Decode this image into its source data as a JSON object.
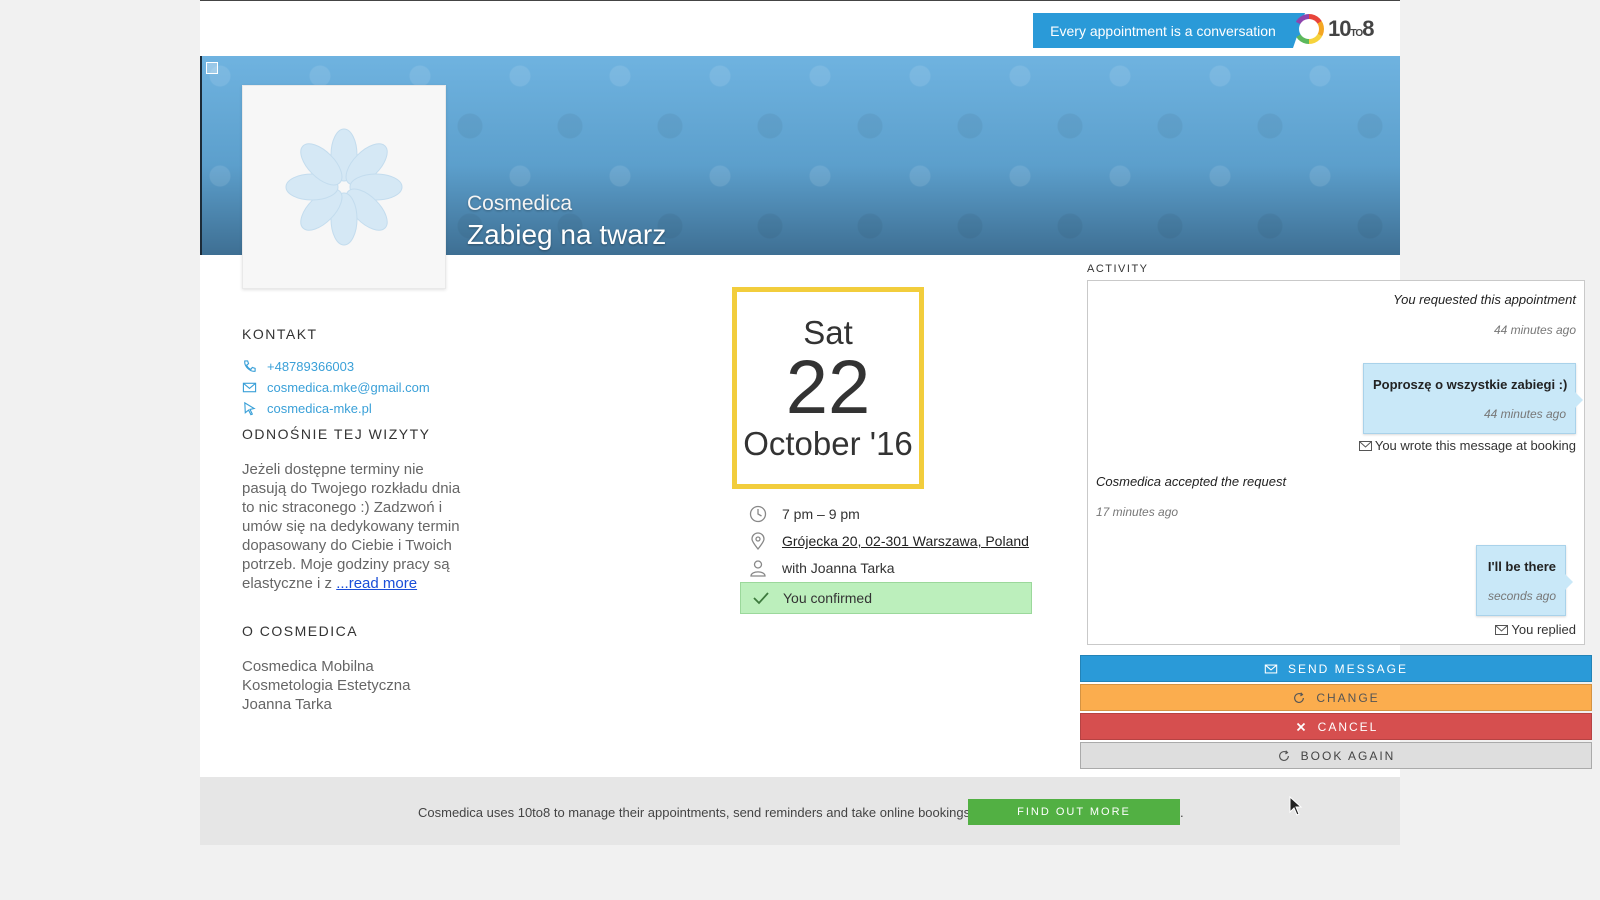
{
  "header": {
    "tagline": "Every appointment is a conversation",
    "logo": {
      "main": "10",
      "small": "TO",
      "end": "8"
    }
  },
  "banner": {
    "business": "Cosmedica",
    "service": "Zabieg na twarz"
  },
  "sidebar": {
    "contact_heading": "KONTAKT",
    "phone": "+48789366003",
    "email": "cosmedica.mke@gmail.com",
    "website": "cosmedica-mke.pl",
    "visit_heading": "ODNOŚNIE TEJ WIZYTY",
    "visit_text": "Jeżeli dostępne terminy nie pasują do Twojego rozkładu dnia to nic straconego :) Zadzwoń i umów się na dedykowany termin dopasowany do Ciebie i Twoich potrzeb. Moje godziny pracy są elastyczne i z",
    "read_more": "...read more",
    "about_heading": "O COSMEDICA",
    "about_text": "Cosmedica Mobilna Kosmetologia Estetyczna Joanna Tarka"
  },
  "appointment": {
    "day_of_week": "Sat",
    "day": "22",
    "month_year": "October '16",
    "time": "7 pm – 9 pm",
    "address": "Grójecka 20, 02-301 Warszawa, Poland",
    "with": "with Joanna Tarka",
    "status": "You confirmed"
  },
  "activity": {
    "heading": "ACTIVITY",
    "items": [
      {
        "text": "You requested this appointment",
        "time": "44 minutes ago"
      },
      {
        "message": "Poproszę o wszystkie zabiegi :)",
        "time": "44 minutes ago",
        "note": "You wrote this message at booking"
      },
      {
        "text": "Cosmedica accepted the request",
        "time": "17 minutes ago"
      },
      {
        "message": "I'll be there",
        "time": "seconds ago",
        "note": "You replied"
      }
    ]
  },
  "actions": {
    "send": "SEND MESSAGE",
    "change": "CHANGE",
    "cancel": "CANCEL",
    "again": "BOOK AGAIN"
  },
  "footer": {
    "text": "Cosmedica uses 10to8 to manage their appointments, send reminders and take online bookings.",
    "button": "FIND OUT MORE",
    "trailing": "."
  },
  "colors": {
    "accent_blue": "#2a9ad8",
    "date_border": "#f2cd3c",
    "confirmed_bg": "#bcefbc",
    "change_orange": "#fbad4e",
    "cancel_red": "#d64f4f",
    "footer_green": "#52b043"
  }
}
